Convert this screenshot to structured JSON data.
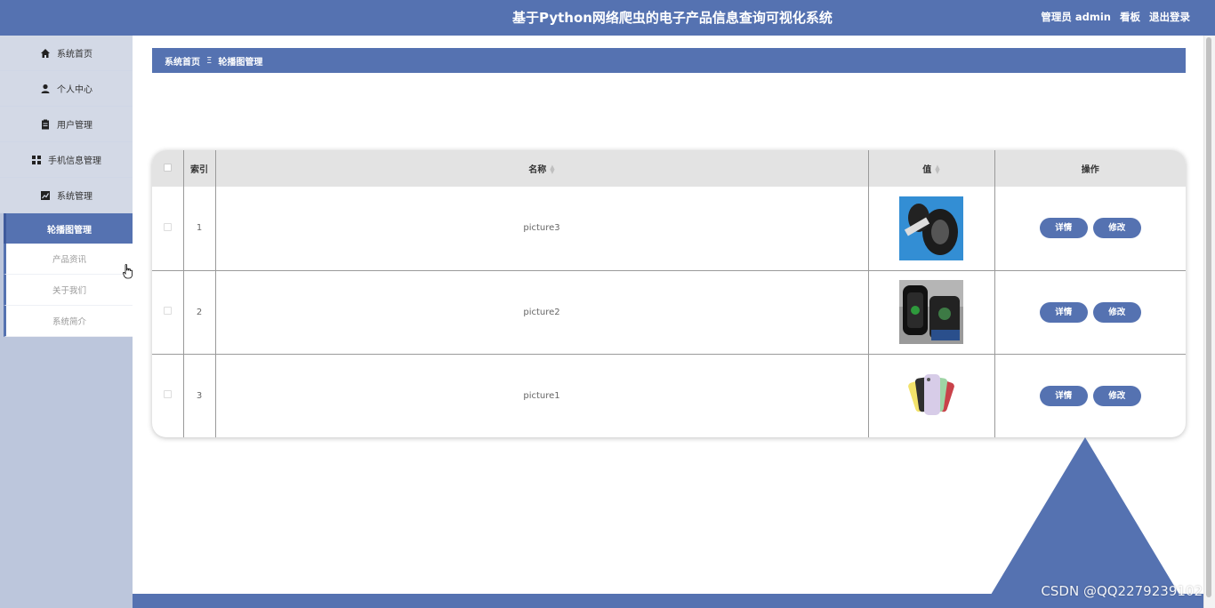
{
  "header": {
    "title": "基于Python网络爬虫的电子产品信息查询可视化系统",
    "user_label": "管理员 admin",
    "board_link": "看板",
    "logout_link": "退出登录"
  },
  "sidebar": {
    "items": [
      {
        "label": "系统首页",
        "icon": "home-icon"
      },
      {
        "label": "个人中心",
        "icon": "person-icon"
      },
      {
        "label": "用户管理",
        "icon": "clipboard-icon"
      },
      {
        "label": "手机信息管理",
        "icon": "grid-icon"
      },
      {
        "label": "系统管理",
        "icon": "chart-icon"
      }
    ],
    "subitems": [
      {
        "label": "轮播图管理",
        "active": true
      },
      {
        "label": "产品资讯",
        "active": false
      },
      {
        "label": "关于我们",
        "active": false
      },
      {
        "label": "系统简介",
        "active": false
      }
    ]
  },
  "breadcrumb": {
    "home": "系统首页",
    "separator": "Ξ",
    "current": "轮播图管理"
  },
  "table": {
    "columns": {
      "index": "索引",
      "name": "名称",
      "value": "值",
      "actions": "操作"
    },
    "rows": [
      {
        "index": "1",
        "name": "picture3"
      },
      {
        "index": "2",
        "name": "picture2"
      },
      {
        "index": "3",
        "name": "picture1"
      }
    ],
    "detail_label": "详情",
    "edit_label": "修改"
  },
  "watermark": "CSDN @QQ2279239102",
  "colors": {
    "primary": "#5572b1",
    "sidebar": "#bcc6dc",
    "header_row": "#e3e3e3"
  }
}
